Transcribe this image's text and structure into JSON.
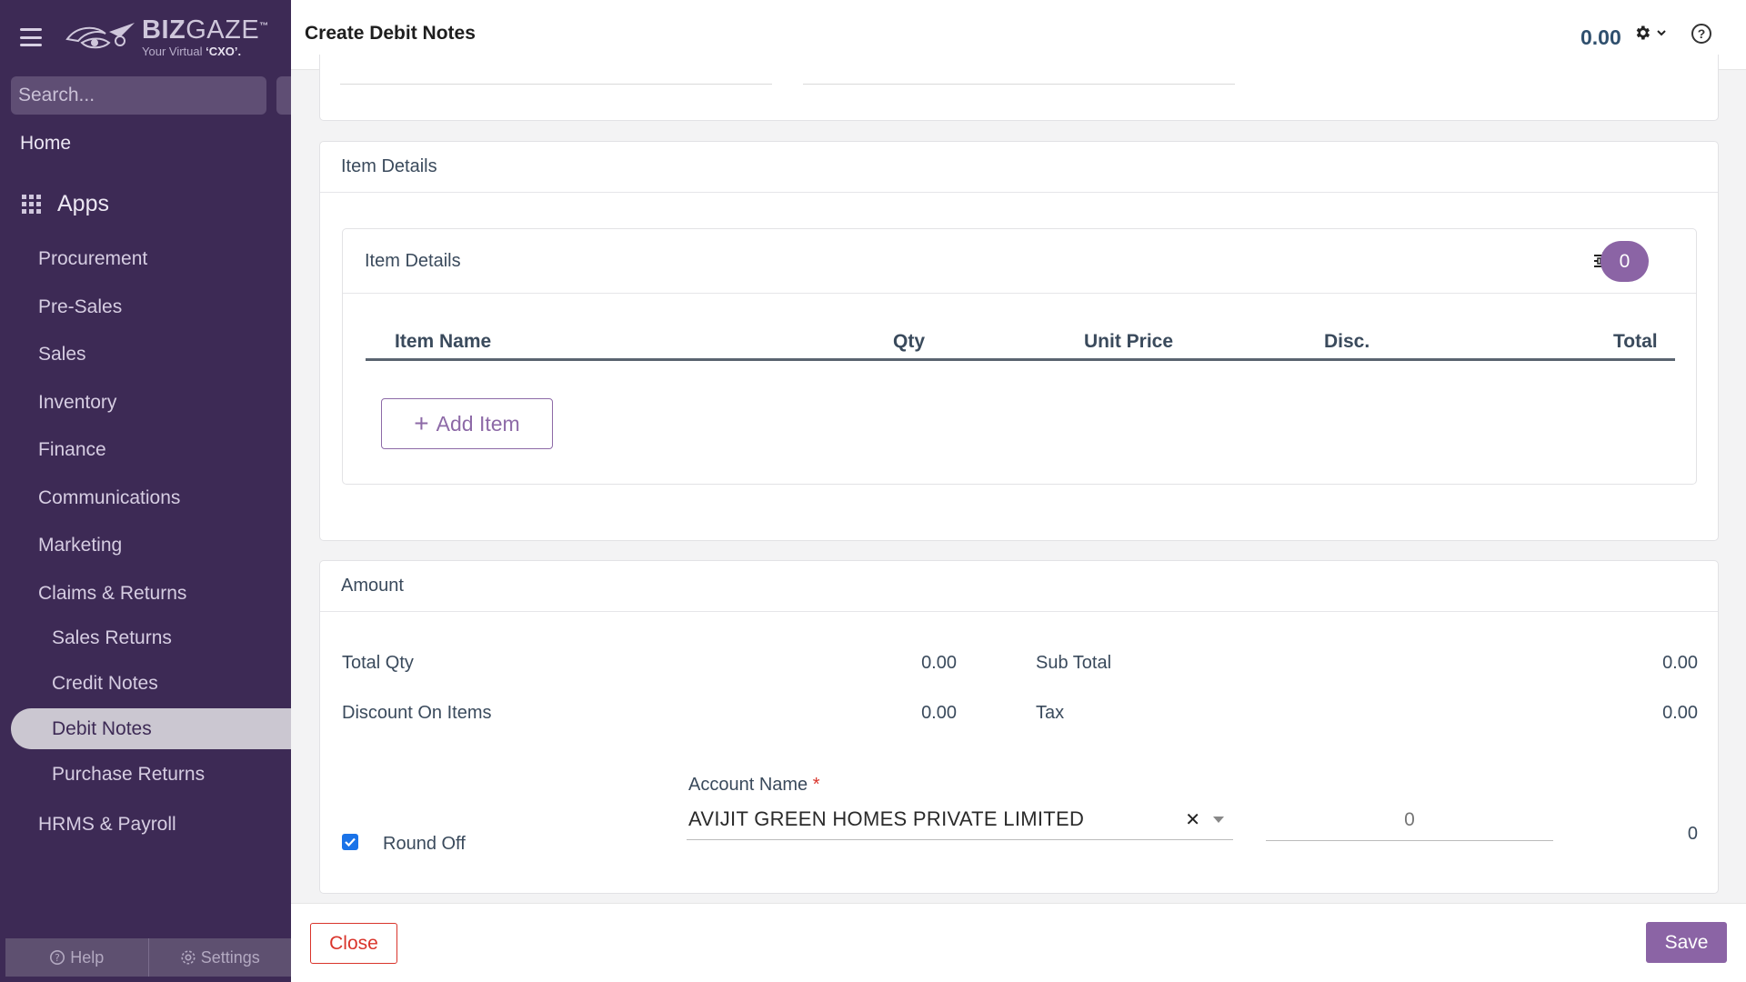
{
  "brand": {
    "name_bold": "BIZ",
    "name_thin": "GAZE",
    "tm": "™",
    "tagline_prefix": "Your Virtual ",
    "tagline_bold": "‘CXO’."
  },
  "sidebar": {
    "search_placeholder": "Search...",
    "home": "Home",
    "apps": "Apps",
    "items": [
      "Procurement",
      "Pre-Sales",
      "Sales",
      "Inventory",
      "Finance",
      "Communications",
      "Marketing",
      "Claims & Returns"
    ],
    "sub_items": [
      "Sales Returns",
      "Credit Notes",
      "Debit Notes",
      "Purchase Returns"
    ],
    "active_item": "Debit Notes",
    "after_item": "HRMS & Payroll",
    "help": "Help",
    "settings": "Settings"
  },
  "header": {
    "title": "Create Debit Notes",
    "amount": "0.00"
  },
  "item_details": {
    "section_title": "Item Details",
    "inner_title": "Item Details",
    "count": "0",
    "columns": [
      "Item Name",
      "Qty",
      "Unit Price",
      "Disc.",
      "Total"
    ],
    "add_item_label": "Add Item"
  },
  "amount": {
    "section_title": "Amount",
    "total_qty_label": "Total Qty",
    "total_qty": "0.00",
    "discount_label": "Discount On Items",
    "discount": "0.00",
    "sub_total_label": "Sub Total",
    "sub_total": "0.00",
    "tax_label": "Tax",
    "tax": "0.00",
    "round_off_label": "Round Off",
    "round_off_checked": true,
    "account_name_label": "Account Name",
    "required_mark": "*",
    "account_name_value": "AVIJIT GREEN HOMES PRIVATE LIMITED",
    "round_off_placeholder": "0",
    "round_off_amount": "0"
  },
  "footer": {
    "close_label": "Close",
    "save_label": "Save"
  },
  "colors": {
    "sidebar_bg": "#3d2a55",
    "accent": "#8b64a5",
    "danger": "#d9342b",
    "text": "#3a4a5c"
  }
}
